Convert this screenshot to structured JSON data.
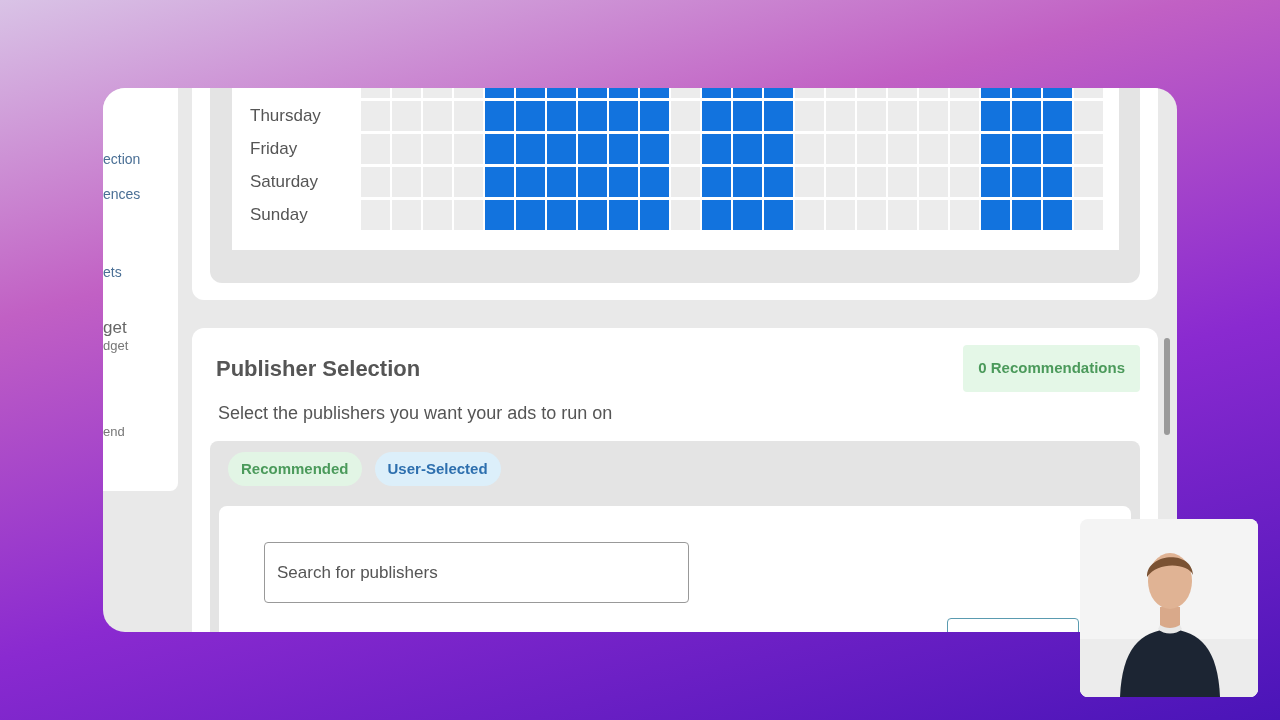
{
  "sidebar": {
    "items": [
      {
        "label": "ection",
        "kind": "link"
      },
      {
        "label": "ences",
        "kind": "link"
      },
      {
        "label": "ets",
        "kind": "link"
      },
      {
        "label": "get",
        "kind": "heading"
      },
      {
        "label": "dget",
        "kind": "sub"
      },
      {
        "label": "end",
        "kind": "sub"
      }
    ]
  },
  "schedule": {
    "rows": [
      {
        "slots": [
          false,
          false,
          false,
          false,
          true,
          true,
          true,
          true,
          true,
          true,
          false,
          true,
          true,
          true,
          false,
          false,
          false,
          false,
          false,
          false,
          true,
          true,
          true,
          false
        ]
      },
      {
        "day": "Thursday",
        "slots": [
          false,
          false,
          false,
          false,
          true,
          true,
          true,
          true,
          true,
          true,
          false,
          true,
          true,
          true,
          false,
          false,
          false,
          false,
          false,
          false,
          true,
          true,
          true,
          false
        ]
      },
      {
        "day": "Friday",
        "slots": [
          false,
          false,
          false,
          false,
          true,
          true,
          true,
          true,
          true,
          true,
          false,
          true,
          true,
          true,
          false,
          false,
          false,
          false,
          false,
          false,
          true,
          true,
          true,
          false
        ]
      },
      {
        "day": "Saturday",
        "slots": [
          false,
          false,
          false,
          false,
          true,
          true,
          true,
          true,
          true,
          true,
          false,
          true,
          true,
          true,
          false,
          false,
          false,
          false,
          false,
          false,
          true,
          true,
          true,
          false
        ]
      },
      {
        "day": "Sunday",
        "slots": [
          false,
          false,
          false,
          false,
          true,
          true,
          true,
          true,
          true,
          true,
          false,
          true,
          true,
          true,
          false,
          false,
          false,
          false,
          false,
          false,
          true,
          true,
          true,
          false
        ]
      }
    ]
  },
  "publisher_selection": {
    "title": "Publisher Selection",
    "badge": "0 Recommendations",
    "subtitle": "Select the publishers you want your ads to run on",
    "tabs": [
      {
        "label": "Recommended",
        "kind": "recommended"
      },
      {
        "label": "User-Selected",
        "kind": "user"
      }
    ],
    "search": {
      "placeholder": "Search for publishers"
    }
  }
}
